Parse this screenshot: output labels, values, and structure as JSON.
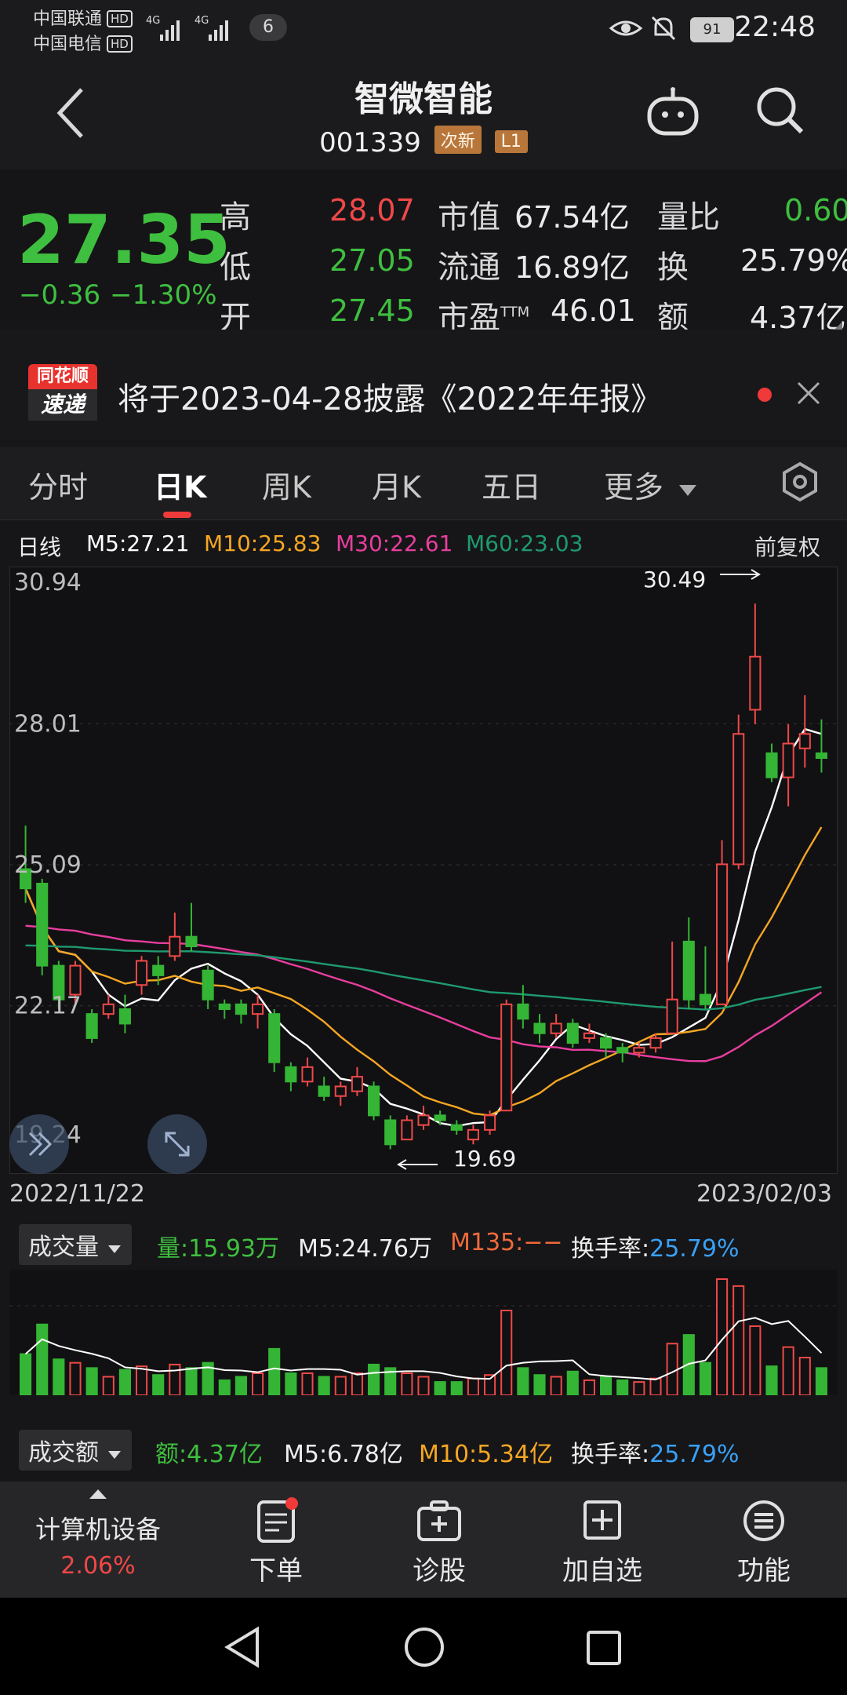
{
  "status": {
    "carrier1": "中国联通",
    "carrier2": "中国电信",
    "hd": "HD",
    "net_type": "4G",
    "badge": "6",
    "battery": "91",
    "time": "22:48"
  },
  "header": {
    "name": "智微智能",
    "code": "001339",
    "tag1": "次新",
    "tag2": "L1"
  },
  "quote": {
    "price": "27.35",
    "change": "−0.36",
    "pct": "−1.30%",
    "high_label": "高",
    "high": "28.07",
    "low_label": "低",
    "low": "27.05",
    "open_label": "开",
    "open": "27.45",
    "mcap_label": "市值",
    "mcap": "67.54亿",
    "float_label": "流通",
    "float": "16.89亿",
    "pe_label": "市盈",
    "pe_sup": "TTM",
    "pe": "46.01",
    "vr_label": "量比",
    "vr": "0.60",
    "turn_label": "换",
    "turn": "25.79%",
    "amt_label": "额",
    "amt": "4.37亿"
  },
  "news": {
    "logo_top": "同花顺",
    "logo_bottom": "速递",
    "text": "将于2023-04-28披露《2022年年报》"
  },
  "tabs": [
    {
      "label": "分时"
    },
    {
      "label": "日K"
    },
    {
      "label": "周K"
    },
    {
      "label": "月K"
    },
    {
      "label": "五日"
    },
    {
      "label": "更多"
    }
  ],
  "ma": {
    "kind": "日线",
    "m5": "M5:27.21",
    "m10": "M10:25.83",
    "m30": "M30:22.61",
    "m60": "M60:23.03",
    "adjust": "前复权"
  },
  "colors": {
    "up": "#f04848",
    "down": "#35b535",
    "m5": "#ffffff",
    "m10": "#f5a623",
    "m30": "#e83e9e",
    "m60": "#1f9a6e"
  },
  "chart_data": {
    "type": "candlestick",
    "y_ticks": [
      "30.94",
      "28.01",
      "25.09",
      "22.17",
      "19.24"
    ],
    "ylim": [
      19.24,
      30.94
    ],
    "x_start": "2022/11/22",
    "x_end": "2023/02/03",
    "max_label": "30.49",
    "min_label": "19.69",
    "candles": [
      [
        25.0,
        24.6,
        25.9,
        24.3
      ],
      [
        24.7,
        23.0,
        24.8,
        22.8
      ],
      [
        23.0,
        22.3,
        23.1,
        22.1
      ],
      [
        22.4,
        23.0,
        23.1,
        22.2
      ],
      [
        22.0,
        21.5,
        22.1,
        21.4
      ],
      [
        22.0,
        22.2,
        22.4,
        21.9
      ],
      [
        22.1,
        21.8,
        22.4,
        21.6
      ],
      [
        22.6,
        23.1,
        23.2,
        22.4
      ],
      [
        23.0,
        22.8,
        23.2,
        22.6
      ],
      [
        23.2,
        23.6,
        24.1,
        23.1
      ],
      [
        23.6,
        23.4,
        24.3,
        23.3
      ],
      [
        22.9,
        22.3,
        23.0,
        22.1
      ],
      [
        22.2,
        22.1,
        22.3,
        21.9
      ],
      [
        22.2,
        22.0,
        22.3,
        21.8
      ],
      [
        22.0,
        22.2,
        22.4,
        21.7
      ],
      [
        22.0,
        21.0,
        22.1,
        20.8
      ],
      [
        20.9,
        20.6,
        21.0,
        20.4
      ],
      [
        20.6,
        20.9,
        21.1,
        20.5
      ],
      [
        20.5,
        20.3,
        20.7,
        20.2
      ],
      [
        20.3,
        20.5,
        20.6,
        20.1
      ],
      [
        20.4,
        20.7,
        20.9,
        20.3
      ],
      [
        20.5,
        19.9,
        20.6,
        19.8
      ],
      [
        19.8,
        19.3,
        19.9,
        19.2
      ],
      [
        19.4,
        19.8,
        19.9,
        19.4
      ],
      [
        19.7,
        19.9,
        20.1,
        19.6
      ],
      [
        19.9,
        19.8,
        20.0,
        19.7
      ],
      [
        19.7,
        19.6,
        19.8,
        19.5
      ],
      [
        19.4,
        19.6,
        19.7,
        19.3
      ],
      [
        19.6,
        19.9,
        20.0,
        19.5
      ],
      [
        20.0,
        22.2,
        22.3,
        20.0
      ],
      [
        22.2,
        21.9,
        22.6,
        21.7
      ],
      [
        21.8,
        21.6,
        22.0,
        21.4
      ],
      [
        21.6,
        21.8,
        22.0,
        21.5
      ],
      [
        21.8,
        21.4,
        21.9,
        21.3
      ],
      [
        21.5,
        21.6,
        21.8,
        21.4
      ],
      [
        21.5,
        21.3,
        21.6,
        21.1
      ],
      [
        21.3,
        21.2,
        21.4,
        21.0
      ],
      [
        21.2,
        21.3,
        21.4,
        21.1
      ],
      [
        21.3,
        21.5,
        21.6,
        21.2
      ],
      [
        21.6,
        22.3,
        23.5,
        21.6
      ],
      [
        23.5,
        22.3,
        24.0,
        22.1
      ],
      [
        22.4,
        22.2,
        23.4,
        22.1
      ],
      [
        22.2,
        25.1,
        25.6,
        22.2
      ],
      [
        25.1,
        27.8,
        28.2,
        25.0
      ],
      [
        28.3,
        29.4,
        30.5,
        28.0
      ],
      [
        27.4,
        26.9,
        27.6,
        26.8
      ],
      [
        26.9,
        27.6,
        28.0,
        26.3
      ],
      [
        27.5,
        27.8,
        28.6,
        27.1
      ],
      [
        27.4,
        27.3,
        28.1,
        27.0
      ]
    ]
  },
  "volume": {
    "label": "成交量",
    "vol": "量:15.93万",
    "m5": "M5:24.76万",
    "m135": "M135:−−",
    "turn_label": "换手率:",
    "turn": "25.79%"
  },
  "amount": {
    "label": "成交额",
    "amt": "额:4.37亿",
    "m5": "M5:6.78亿",
    "m10": "M10:5.34亿",
    "turn_label": "换手率:",
    "turn": "25.79%"
  },
  "toolbar": {
    "industry": "计算机设备",
    "industry_pct": "2.06%",
    "order": "下单",
    "diagnose": "诊股",
    "add_watch": "加自选",
    "functions": "功能"
  }
}
